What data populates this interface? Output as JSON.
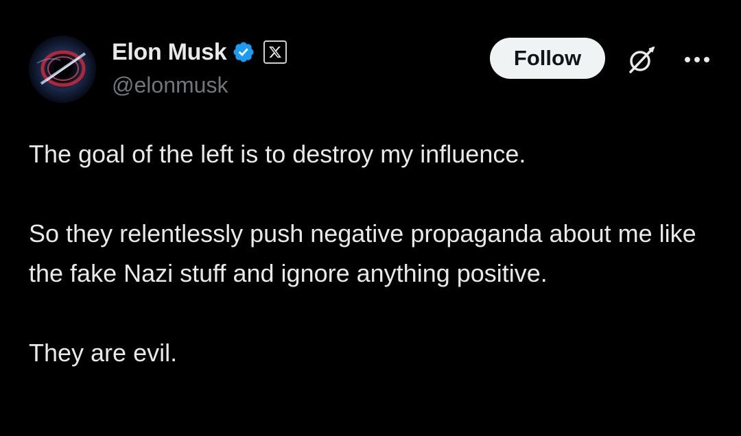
{
  "author": {
    "display_name": "Elon Musk",
    "handle": "@elonmusk",
    "verified": true,
    "affiliate_badge_glyph": "𝕏"
  },
  "actions": {
    "follow_label": "Follow",
    "grok_icon": "grok-icon",
    "more_icon": "more-options-icon"
  },
  "tweet": {
    "paragraphs": [
      "The goal of the left is to destroy my influence.",
      "So they relentlessly push negative propaganda about me like the fake Nazi stuff and ignore anything positive.",
      "They are evil."
    ]
  },
  "colors": {
    "background": "#000000",
    "text_primary": "#e7e9ea",
    "text_secondary": "#71767b",
    "verified_blue": "#1d9bf0",
    "follow_bg": "#eff3f4",
    "follow_text": "#0f1419"
  }
}
